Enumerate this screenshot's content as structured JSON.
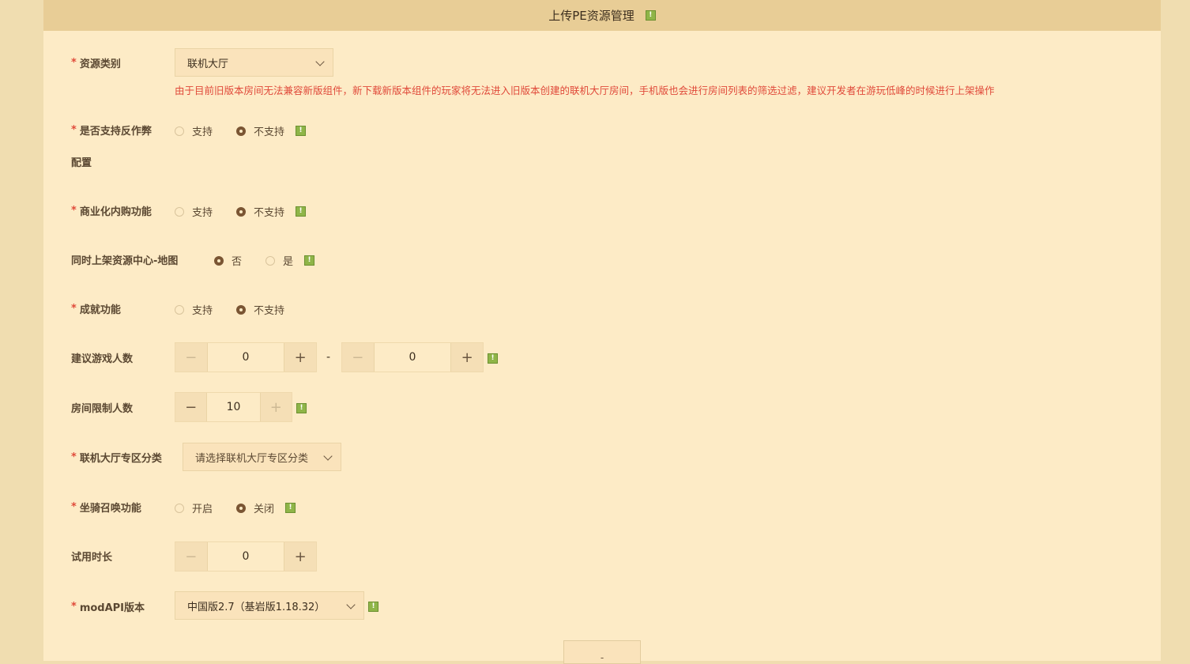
{
  "header": {
    "title": "上传PE资源管理"
  },
  "fields": {
    "resource_type": {
      "label": "资源类别",
      "value": "联机大厅",
      "warning": "由于目前旧版本房间无法兼容新版组件，新下载新版本组件的玩家将无法进入旧版本创建的联机大厅房间，手机版也会进行房间列表的筛选过滤，建议开发者在游玩低峰的时候进行上架操作"
    },
    "anti_cheat": {
      "label": "是否支持反作弊",
      "options": [
        "支持",
        "不支持"
      ],
      "selected": "不支持"
    },
    "config": {
      "label": "配置"
    },
    "iap": {
      "label": "商业化内购功能",
      "options": [
        "支持",
        "不支持"
      ],
      "selected": "不支持"
    },
    "list_map": {
      "label": "同时上架资源中心-地图",
      "options": [
        "否",
        "是"
      ],
      "selected": "否"
    },
    "achievement": {
      "label": "成就功能",
      "options": [
        "支持",
        "不支持"
      ],
      "selected": "不支持"
    },
    "players": {
      "label": "建议游戏人数",
      "min": "0",
      "separator": "-",
      "max": "0"
    },
    "room_limit": {
      "label": "房间限制人数",
      "value": "10"
    },
    "lobby_category": {
      "label": "联机大厅专区分类",
      "placeholder": "请选择联机大厅专区分类"
    },
    "mount": {
      "label": "坐骑召唤功能",
      "options": [
        "开启",
        "关闭"
      ],
      "selected": "关闭"
    },
    "trial": {
      "label": "试用时长",
      "value": "0"
    },
    "modapi": {
      "label": "modAPI版本",
      "value": "中国版2.7（基岩版1.18.32）"
    }
  },
  "icons": {
    "minus": "−",
    "plus": "+",
    "help": "!"
  },
  "required_mark": "*",
  "bottom_button": {
    "label": "-"
  }
}
